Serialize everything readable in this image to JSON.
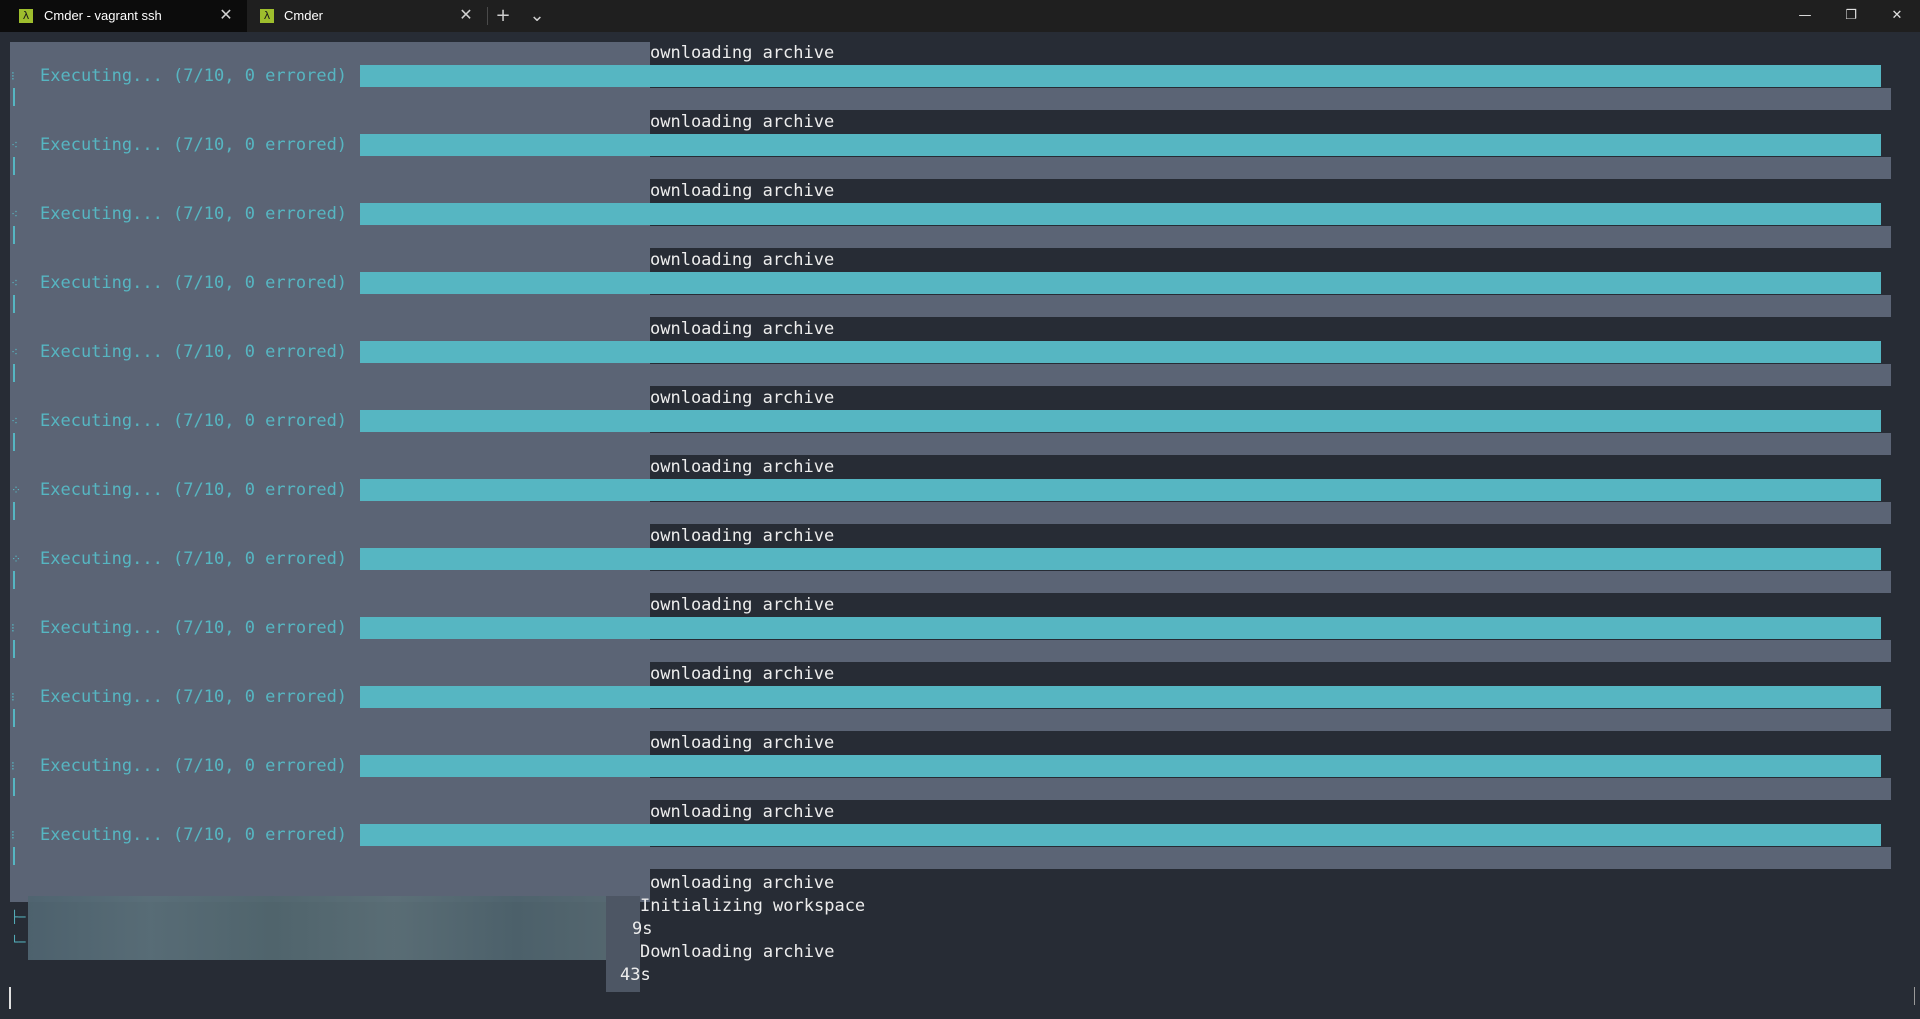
{
  "tabs": [
    {
      "title": "Cmder - vagrant  ssh",
      "icon": "lambda-icon",
      "active": true,
      "close": "✕"
    },
    {
      "title": "Cmder",
      "icon": "lambda-icon",
      "active": false,
      "close": "✕"
    }
  ],
  "tabbar": {
    "new_tab": "+",
    "dropdown": "⌄"
  },
  "window_controls": {
    "minimize": "—",
    "restore": "❐",
    "close": "✕"
  },
  "terminal": {
    "blocks": [
      {
        "download": "ownloading archive",
        "exec": "Executing... (7/10, 0 errored)",
        "glyph": "⁝",
        "progress": 1.0
      },
      {
        "download": "ownloading archive",
        "exec": "Executing... (7/10, 0 errored)",
        "glyph": "⁖",
        "progress": 1.0
      },
      {
        "download": "ownloading archive",
        "exec": "Executing... (7/10, 0 errored)",
        "glyph": "⁖",
        "progress": 1.0
      },
      {
        "download": "ownloading archive",
        "exec": "Executing... (7/10, 0 errored)",
        "glyph": "⁖",
        "progress": 1.0
      },
      {
        "download": "ownloading archive",
        "exec": "Executing... (7/10, 0 errored)",
        "glyph": "⁖",
        "progress": 1.0
      },
      {
        "download": "ownloading archive",
        "exec": "Executing... (7/10, 0 errored)",
        "glyph": "⁖",
        "progress": 1.0
      },
      {
        "download": "ownloading archive",
        "exec": "Executing... (7/10, 0 errored)",
        "glyph": "⁘",
        "progress": 1.0
      },
      {
        "download": "ownloading archive",
        "exec": "Executing... (7/10, 0 errored)",
        "glyph": "⁘",
        "progress": 1.0
      },
      {
        "download": "ownloading archive",
        "exec": "Executing... (7/10, 0 errored)",
        "glyph": "⁝",
        "progress": 1.0
      },
      {
        "download": "ownloading archive",
        "exec": "Executing... (7/10, 0 errored)",
        "glyph": "⁝",
        "progress": 1.0
      },
      {
        "download": "ownloading archive",
        "exec": "Executing... (7/10, 0 errored)",
        "glyph": "⁝",
        "progress": 1.0
      },
      {
        "download": "ownloading archive",
        "exec": "Executing... (7/10, 0 errored)",
        "glyph": "⁝",
        "progress": 1.0
      }
    ],
    "tail": {
      "line1": "ownloading archive",
      "line2": "Initializing workspace",
      "line3": "9s",
      "line4": "Downloading archive",
      "line5": "43s",
      "glyph_a": "├─",
      "glyph_b": "└─"
    }
  },
  "colors": {
    "accent": "#56b6c2",
    "background": "#272c35",
    "selection": "#5b6475",
    "tab_icon": "#9ebe2d"
  }
}
